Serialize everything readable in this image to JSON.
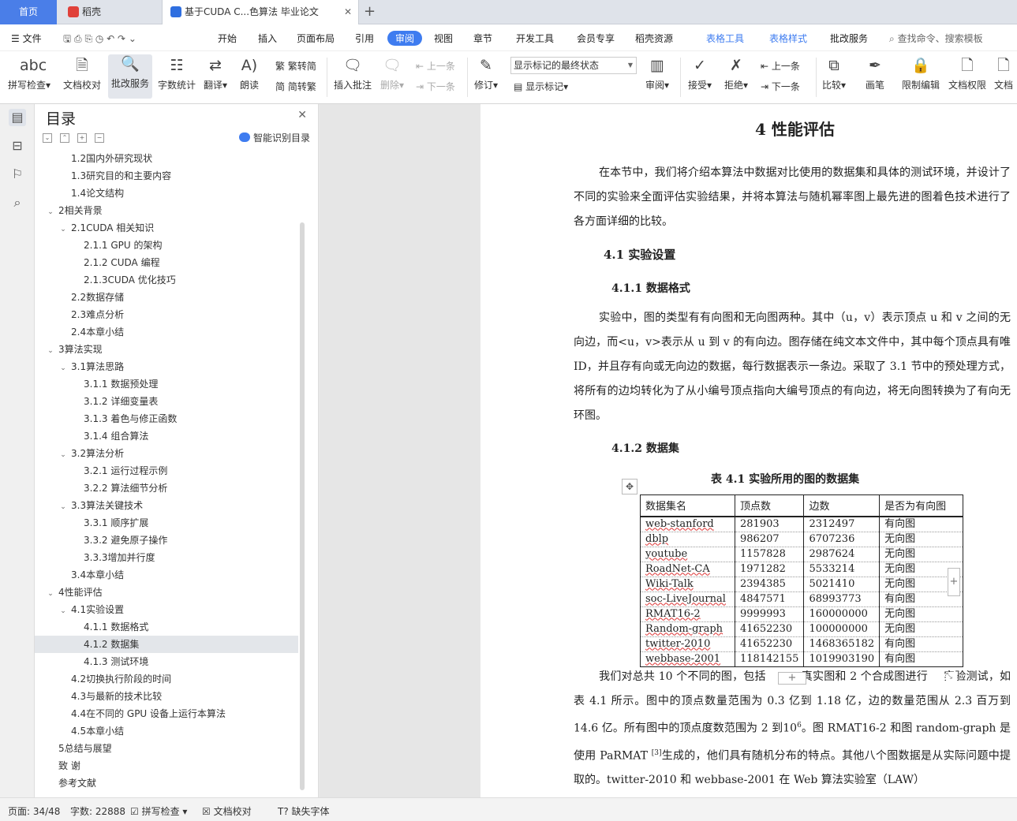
{
  "tabs": {
    "home": "首页",
    "daoke": "稻壳",
    "doc": "基于CUDA C...色算法 毕业论文"
  },
  "menu": {
    "file": "文件",
    "items": [
      "开始",
      "插入",
      "页面布局",
      "引用",
      "审阅",
      "视图",
      "章节",
      "开发工具",
      "会员专享",
      "稻壳资源"
    ],
    "table_tools": "表格工具",
    "table_style": "表格样式",
    "correction": "批改服务",
    "search": "查找命令、搜索模板"
  },
  "ribbon": {
    "spell": "拼写检查",
    "proof": "文档校对",
    "correct_service": "批改服务",
    "word_count": "字数统计",
    "translate": "翻译",
    "read": "朗读",
    "to_trad": "繁转简",
    "to_simp": "简转繁",
    "insert_comment": "插入批注",
    "delete": "删除",
    "prev": "上一条",
    "next": "下一条",
    "revise": "修订",
    "markup_state": "显示标记的最终状态",
    "show_markup": "显示标记",
    "review": "审阅",
    "accept": "接受",
    "reject": "拒绝",
    "prev2": "上一条",
    "next2": "下一条",
    "compare": "比较",
    "pen": "画笔",
    "restrict": "限制编辑",
    "doc_perm": "文档权限",
    "doc_more": "文档"
  },
  "toc": {
    "title": "目录",
    "smart": "智能识别目录",
    "items": [
      {
        "text": "1.2国内外研究现状",
        "level": 2,
        "caret": false
      },
      {
        "text": "1.3研究目的和主要内容",
        "level": 2,
        "caret": false
      },
      {
        "text": "1.4论文结构",
        "level": 2,
        "caret": false
      },
      {
        "text": "2相关背景",
        "level": 1,
        "caret": true
      },
      {
        "text": "2.1CUDA 相关知识",
        "level": 2,
        "caret": true
      },
      {
        "text": "2.1.1  GPU 的架构",
        "level": 3,
        "caret": false
      },
      {
        "text": "2.1.2  CUDA 编程",
        "level": 3,
        "caret": false
      },
      {
        "text": "2.1.3CUDA 优化技巧",
        "level": 3,
        "caret": false
      },
      {
        "text": "2.2数据存储",
        "level": 2,
        "caret": false
      },
      {
        "text": "2.3难点分析",
        "level": 2,
        "caret": false
      },
      {
        "text": "2.4本章小结",
        "level": 2,
        "caret": false
      },
      {
        "text": "3算法实现",
        "level": 1,
        "caret": true
      },
      {
        "text": "3.1算法思路",
        "level": 2,
        "caret": true
      },
      {
        "text": "3.1.1  数据预处理",
        "level": 3,
        "caret": false
      },
      {
        "text": "3.1.2  详细变量表",
        "level": 3,
        "caret": false
      },
      {
        "text": "3.1.3  着色与修正函数",
        "level": 3,
        "caret": false
      },
      {
        "text": "3.1.4  组合算法",
        "level": 3,
        "caret": false
      },
      {
        "text": "3.2算法分析",
        "level": 2,
        "caret": true
      },
      {
        "text": "3.2.1  运行过程示例",
        "level": 3,
        "caret": false
      },
      {
        "text": "3.2.2  算法细节分析",
        "level": 3,
        "caret": false
      },
      {
        "text": "3.3算法关键技术",
        "level": 2,
        "caret": true
      },
      {
        "text": "3.3.1  顺序扩展",
        "level": 3,
        "caret": false
      },
      {
        "text": "3.3.2  避免原子操作",
        "level": 3,
        "caret": false
      },
      {
        "text": "3.3.3增加并行度",
        "level": 3,
        "caret": false
      },
      {
        "text": "3.4本章小结",
        "level": 2,
        "caret": false
      },
      {
        "text": "4性能评估",
        "level": 1,
        "caret": true
      },
      {
        "text": "4.1实验设置",
        "level": 2,
        "caret": true
      },
      {
        "text": "4.1.1  数据格式",
        "level": 3,
        "caret": false
      },
      {
        "text": "4.1.2  数据集",
        "level": 3,
        "caret": false,
        "selected": true
      },
      {
        "text": "4.1.3  测试环境",
        "level": 3,
        "caret": false
      },
      {
        "text": "4.2切换执行阶段的时间",
        "level": 2,
        "caret": false
      },
      {
        "text": "4.3与最新的技术比较",
        "level": 2,
        "caret": false
      },
      {
        "text": "4.4在不同的 GPU 设备上运行本算法",
        "level": 2,
        "caret": false
      },
      {
        "text": "4.5本章小结",
        "level": 2,
        "caret": false
      },
      {
        "text": "5总结与展望",
        "level": 1,
        "caret": false
      },
      {
        "text": "致    谢",
        "level": 1,
        "caret": false
      },
      {
        "text": "参考文献",
        "level": 1,
        "caret": false
      }
    ]
  },
  "doc": {
    "chapter": "4   性能评估",
    "intro": "在本节中，我们将介绍本算法中数据对比使用的数据集和具体的测试环境，并设计了不同的实验来全面评估实验结果，并将本算法与随机幂率图上最先进的图着色技术进行了各方面详细的比较。",
    "sec41": "4.1    实验设置",
    "sec411": "4.1.1  数据格式",
    "p411": "实验中，图的类型有有向图和无向图两种。其中（u，v）表示顶点 u 和 v 之间的无向边，而<u，v>表示从 u 到 v 的有向边。图存储在纯文本文件中，其中每个顶点具有唯 ID，并且存有向或无向边的数据，每行数据表示一条边。采取了 3.1 节中的预处理方式，将所有的边均转化为了从小编号顶点指向大编号顶点的有向边，将无向图转换为了有向无环图。",
    "sec412": "4.1.2  数据集",
    "caption": "表 4.1  实验所用的图的数据集",
    "table_headers": [
      "数据集名",
      "顶点数",
      "边数",
      "是否为有向图"
    ],
    "table_rows": [
      [
        "web-stanford",
        "281903",
        "2312497",
        "有向图"
      ],
      [
        "dblp",
        "986207",
        "6707236",
        "无向图"
      ],
      [
        "youtube",
        "1157828",
        "2987624",
        "无向图"
      ],
      [
        "RoadNet-CA",
        "1971282",
        "5533214",
        "无向图"
      ],
      [
        "Wiki-Talk",
        "2394385",
        "5021410",
        "无向图"
      ],
      [
        "soc-LiveJournal",
        "4847571",
        "68993773",
        "有向图"
      ],
      [
        "RMAT16-2",
        "9999993",
        "160000000",
        "无向图"
      ],
      [
        "Random-graph",
        "41652230",
        "100000000",
        "无向图"
      ],
      [
        "twitter-2010",
        "41652230",
        "1468365182",
        "有向图"
      ],
      [
        "webbase-2001",
        "118142155",
        "1019903190",
        "有向图"
      ]
    ],
    "p_after_1": "我们对总共 10 个不同的图，包括",
    "p_after_2": "真实图和 2 个合成图进行",
    "p_after_3": "实验测试，如表 4.1 所示。图中的顶点数量范围为 0.3 亿到 1.18 亿，边的数量范围从 2.3 百万到 14.6 亿。所有图中的顶点度数范围为 2 到10",
    "p_after_sup": "6",
    "p_after_4": "。图 RMAT16-2 和图 random-graph 是使用 PaRMAT ",
    "p_after_ref": "[3]",
    "p_after_5": "生成的，他们具有随机分布的特点。其他八个图数据是从实际问题中提取的。twitter-2010 和 webbase-2001 在 Web 算法实验室（LAW）"
  },
  "status": {
    "page": "页面: 34/48",
    "words": "字数: 22888",
    "spell": "拼写检查",
    "proof": "文档校对",
    "font": "缺失字体"
  }
}
